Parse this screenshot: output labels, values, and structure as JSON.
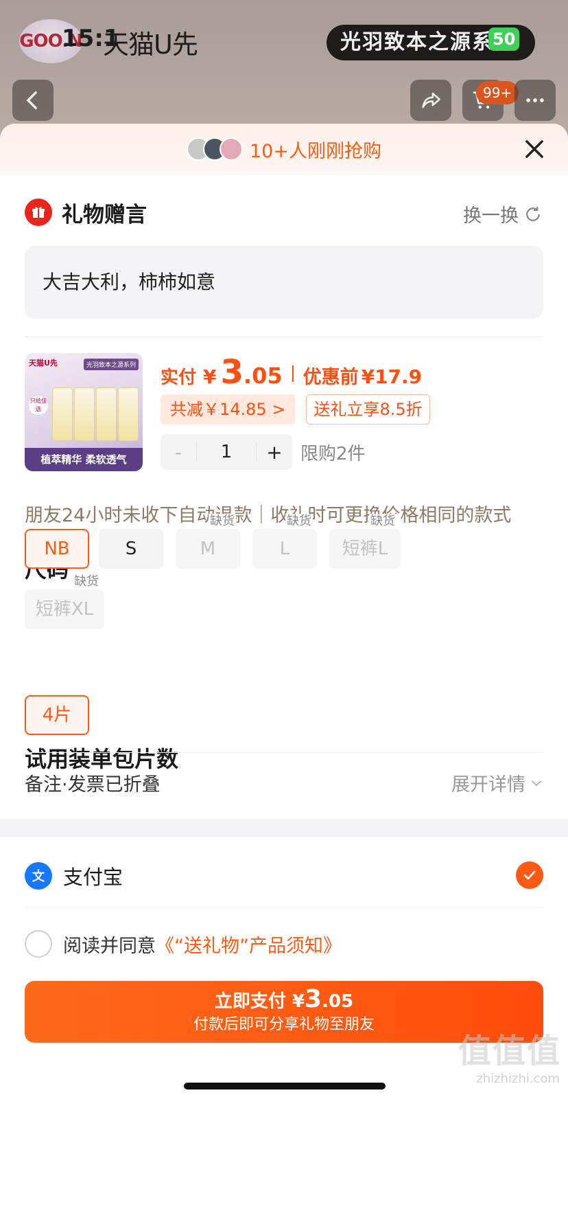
{
  "background": {
    "logo_text": "GOO.N",
    "status_time": "15:1",
    "brand": "天猫U先",
    "top_pill": "光羽致本之源系列",
    "battery": "50",
    "cart_badge": "99+"
  },
  "banner": {
    "text": "10+人刚刚抢购",
    "avatar_colors": [
      "#c9c9c9",
      "#4a5560",
      "#e4a9b6"
    ]
  },
  "gift": {
    "title": "礼物赠言",
    "refresh_label": "换一换",
    "message": "大吉大利，柿柿如意"
  },
  "product": {
    "thumb": {
      "brand": "天猫U先",
      "series": "光羽致本之源系列",
      "tag": "只给佳选",
      "caption": "植萃精华 柔软透气"
    },
    "pay_label": "实付",
    "currency": "¥",
    "pay_int": "3",
    "pay_dec": ".05",
    "before_label": "优惠前",
    "before_price": "¥17.9",
    "save_chip": "共减￥14.85 >",
    "discount_chip": "送礼立享8.5折",
    "qty_minus": "-",
    "qty_value": "1",
    "qty_plus": "+",
    "limit": "限购2件"
  },
  "notice": "朋友24小时未收下自动退款｜收礼时可更换价格相同的款式",
  "size": {
    "title": "尺码",
    "out_label": "缺货",
    "options": [
      "NB",
      "S",
      "M",
      "L",
      "短裤L",
      "短裤XL"
    ]
  },
  "trial": {
    "title": "试用装单包片数",
    "options": [
      "4片"
    ]
  },
  "remark": {
    "label": "备注·发票已折叠",
    "expand": "展开详情"
  },
  "payment": {
    "method": "支付宝",
    "agree_prefix": "阅读并同意",
    "agree_link": "《“送礼物”产品须知》"
  },
  "pay_button": {
    "prefix": "立即支付 ¥",
    "amount_int": "3",
    "amount_dec": ".05",
    "subtitle": "付款后即可分享礼物至朋友"
  },
  "watermark": {
    "main": "值值值",
    "site": "zhizhizhi.com"
  },
  "colors": {
    "accent": "#ff5a14",
    "alipay": "#1677ff",
    "gift": "#e9251d"
  }
}
